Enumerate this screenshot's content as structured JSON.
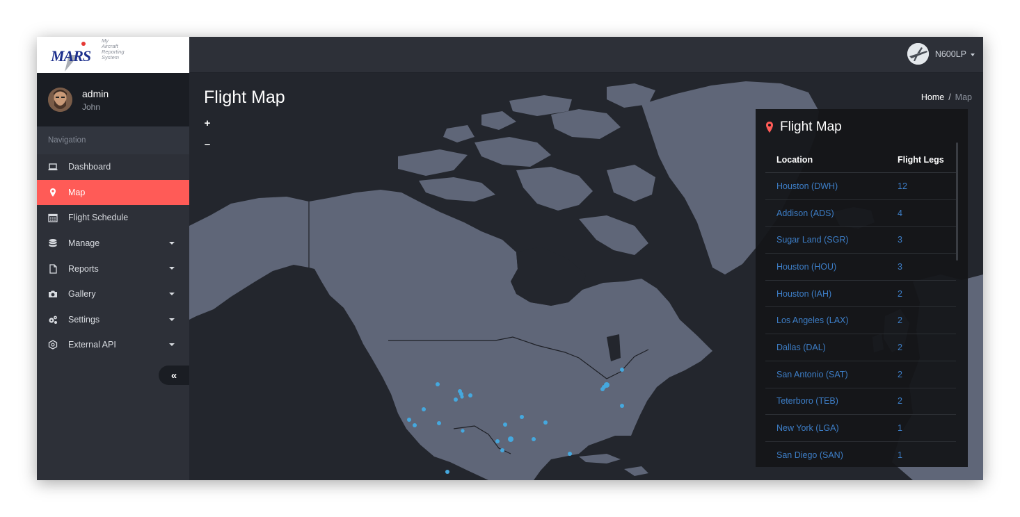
{
  "app": {
    "logo_text": "MARS",
    "logo_tagline": [
      "My",
      "Aircraft",
      "Reporting",
      "System"
    ]
  },
  "profile": {
    "name": "admin",
    "subtitle": "John"
  },
  "nav": {
    "header": "Navigation",
    "items": [
      {
        "label": "Dashboard",
        "icon": "laptop-icon",
        "active": false,
        "has_caret": false
      },
      {
        "label": "Map",
        "icon": "map-marker-icon",
        "active": true,
        "has_caret": false
      },
      {
        "label": "Flight Schedule",
        "icon": "calendar-icon",
        "active": false,
        "has_caret": false
      },
      {
        "label": "Manage",
        "icon": "database-icon",
        "active": false,
        "has_caret": true
      },
      {
        "label": "Reports",
        "icon": "file-icon",
        "active": false,
        "has_caret": true
      },
      {
        "label": "Gallery",
        "icon": "camera-icon",
        "active": false,
        "has_caret": true
      },
      {
        "label": "Settings",
        "icon": "gears-icon",
        "active": false,
        "has_caret": true
      },
      {
        "label": "External API",
        "icon": "api-icon",
        "active": false,
        "has_caret": true
      }
    ],
    "collapse_label": "«"
  },
  "topbar": {
    "user_label": "N600LP"
  },
  "page": {
    "title": "Flight Map",
    "breadcrumb_home": "Home",
    "breadcrumb_sep": "/",
    "breadcrumb_current": "Map"
  },
  "map": {
    "zoom_in": "+",
    "zoom_out": "–",
    "land_color": "#5f6678",
    "water_color": "#23262d",
    "marker_color": "#45a8de"
  },
  "panel": {
    "title": "Flight Map",
    "columns": [
      "Location",
      "Flight Legs"
    ],
    "rows": [
      {
        "location": "Houston (DWH)",
        "legs": "12"
      },
      {
        "location": "Addison (ADS)",
        "legs": "4"
      },
      {
        "location": "Sugar Land (SGR)",
        "legs": "3"
      },
      {
        "location": "Houston (HOU)",
        "legs": "3"
      },
      {
        "location": "Houston (IAH)",
        "legs": "2"
      },
      {
        "location": "Los Angeles (LAX)",
        "legs": "2"
      },
      {
        "location": "Dallas (DAL)",
        "legs": "2"
      },
      {
        "location": "San Antonio (SAT)",
        "legs": "2"
      },
      {
        "location": "Teterboro (TEB)",
        "legs": "2"
      },
      {
        "location": "New York (LGA)",
        "legs": "1"
      },
      {
        "location": "San Diego (SAN)",
        "legs": "1"
      }
    ]
  }
}
